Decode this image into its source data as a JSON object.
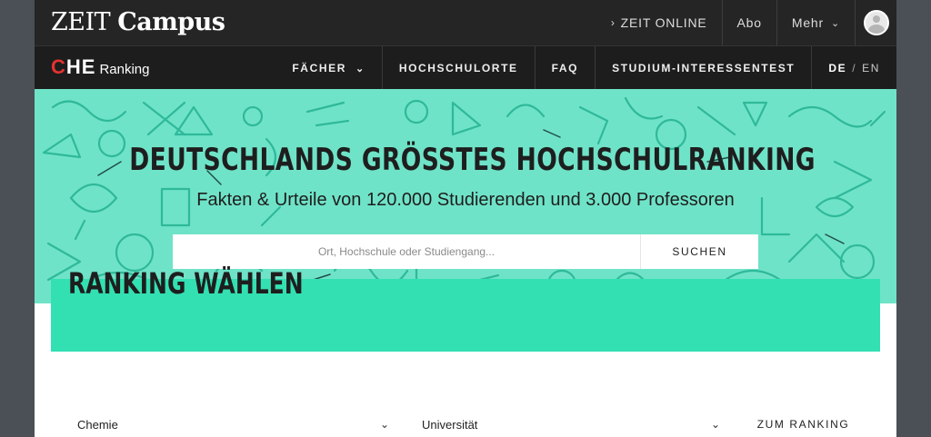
{
  "colors": {
    "topbar": "#252525",
    "chebar": "#1d1d1d",
    "hero_bg": "#6fe3c8",
    "panel": "#33e0b2",
    "che_red": "#e5322e"
  },
  "topbar": {
    "logo_regular": "ZEIT",
    "logo_bold": "Campus",
    "nav": {
      "zeit_online_chev": "›",
      "zeit_online": "ZEIT ONLINE",
      "abo": "Abo",
      "mehr": "Mehr",
      "mehr_chev": "⌄"
    },
    "avatar_icon": "user-avatar-icon"
  },
  "chebar": {
    "logo_c": "C",
    "logo_he": "HE",
    "logo_ranking": "Ranking",
    "nav": {
      "faecher": "FÄCHER",
      "faecher_chev": "⌄",
      "hochschulorte": "HOCHSCHULORTE",
      "faq": "FAQ",
      "interessentest": "STUDIUM-INTERESSENTEST",
      "lang_de": "DE",
      "lang_sep": "/",
      "lang_en": "EN"
    }
  },
  "hero": {
    "title": "DEUTSCHLANDS GRÖSSTES HOCHSCHULRANKING",
    "subtitle": "Fakten & Urteile von 120.000 Studierenden und 3.000 Professoren",
    "search_placeholder": "Ort, Hochschule oder Studiengang...",
    "search_button": "SUCHEN"
  },
  "ranking": {
    "heading": "RANKING WÄHLEN",
    "subject_value": "Chemie",
    "type_value": "Universität",
    "chev": "⌄",
    "button": "ZUM RANKING"
  }
}
